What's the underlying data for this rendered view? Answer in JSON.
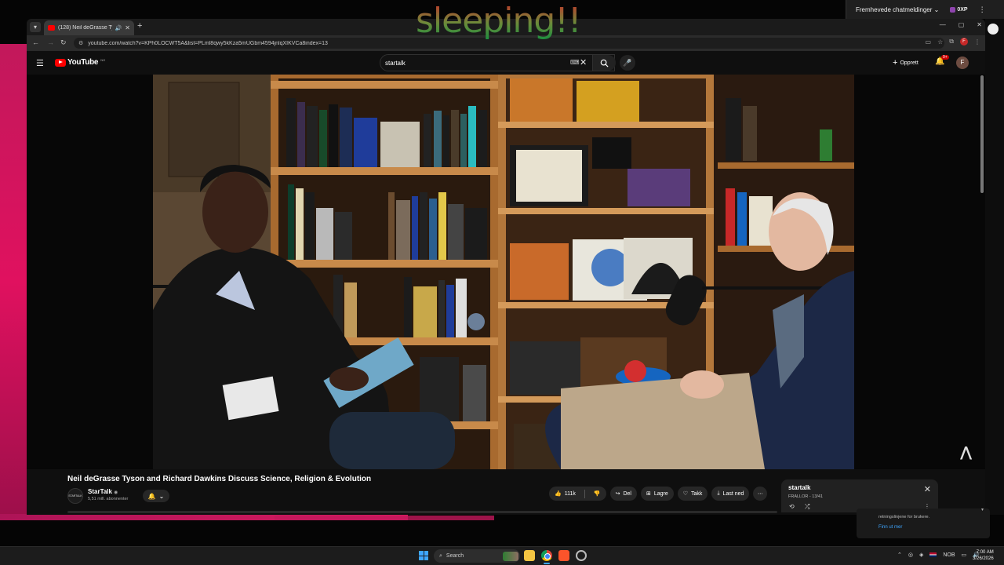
{
  "overlay_text": "sleeping!!",
  "chat_panel": {
    "header_label": "Fremhevede chatmeldinger",
    "points": "0XP",
    "notice_text": "retningslinjene for brukere.",
    "notice_link": "Finn ut mer"
  },
  "browser": {
    "tab_title": "(128) Neil deGrasse Tyson a",
    "url": "youtube.com/watch?v=KPh0LOCWT5A&list=PLml8qwy5kKza5mUGbm4594jnlqXIKVCa8index=13",
    "profile_letter": "F"
  },
  "youtube": {
    "logo_text": "YouTube",
    "logo_region": "NO",
    "search_value": "startalk",
    "create_label": "Opprett",
    "notification_count": "9+",
    "avatar_letter": "F"
  },
  "video": {
    "title": "Neil deGrasse Tyson and Richard Dawkins Discuss Science, Religion & Evolution",
    "channel_avatar_text": "STARTALK",
    "channel_name": "StarTalk",
    "subscribers": "5,51 mill. abonnenter",
    "like_count": "111k",
    "share_label": "Del",
    "save_label": "Lagre",
    "thanks_label": "Takk",
    "download_label": "Last ned"
  },
  "playlist": {
    "title": "startalk",
    "subtitle": "FRALLOR - 13/41"
  },
  "taskbar": {
    "search_label": "Search",
    "language": "NOB",
    "time": "7:00 AM",
    "date": "3/26/2026"
  },
  "colors": {
    "youtube_red": "#ff0000",
    "background": "#0f0f0f",
    "pill": "#272727",
    "link_blue": "#3ea6ff"
  }
}
